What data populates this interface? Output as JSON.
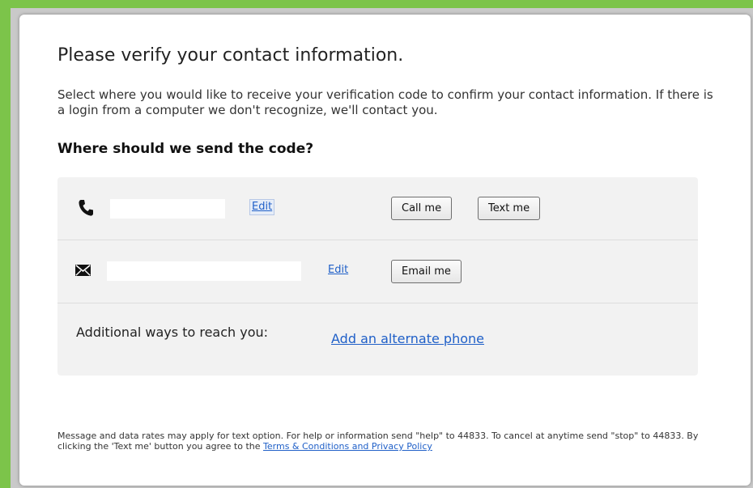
{
  "dialog": {
    "title": "Please verify your contact information.",
    "intro": "Select where you would like to receive your verification code to confirm your contact information. If there is a login from a computer we don't recognize, we'll contact you.",
    "question": "Where should we send the code?"
  },
  "phone_row": {
    "icon": "phone-icon",
    "value": "",
    "edit_label": "Edit",
    "call_label": "Call me",
    "text_label": "Text me"
  },
  "email_row": {
    "icon": "envelope-icon",
    "value": "",
    "edit_label": "Edit",
    "email_label": "Email me"
  },
  "alternate_row": {
    "label": "Additional ways to reach you:",
    "link": "Add an alternate phone"
  },
  "footer": {
    "text": "Message and data rates may apply for text option. For help or information send \"help\" to 44833. To cancel at anytime send \"stop\" to 44833. By clicking the 'Text me' button you agree to the",
    "terms_link": "Terms & Conditions and Privacy Policy"
  },
  "colors": {
    "frame": "#7cc44a",
    "link": "#2060c8",
    "panel": "#f2f2f2"
  }
}
